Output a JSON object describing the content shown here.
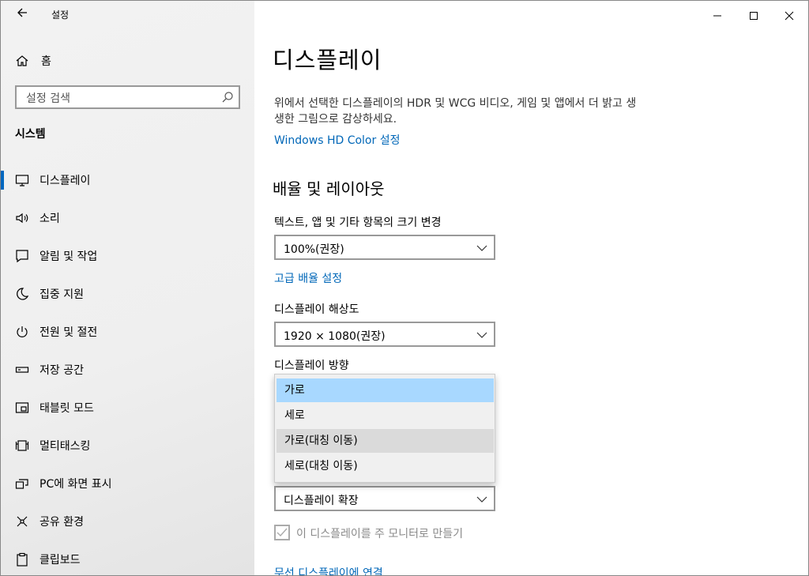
{
  "titlebar": {
    "title": "설정"
  },
  "sidebar": {
    "home_label": "홈",
    "search_placeholder": "설정 검색",
    "section": "시스템",
    "items": [
      {
        "label": "디스플레이",
        "icon": "monitor-icon",
        "selected": true
      },
      {
        "label": "소리",
        "icon": "speaker-icon"
      },
      {
        "label": "알림 및 작업",
        "icon": "notification-icon"
      },
      {
        "label": "집중 지원",
        "icon": "moon-icon"
      },
      {
        "label": "전원 및 절전",
        "icon": "power-icon"
      },
      {
        "label": "저장 공간",
        "icon": "storage-icon"
      },
      {
        "label": "태블릿 모드",
        "icon": "tablet-icon"
      },
      {
        "label": "멀티태스킹",
        "icon": "multitasking-icon"
      },
      {
        "label": "PC에 화면 표시",
        "icon": "project-icon"
      },
      {
        "label": "공유 환경",
        "icon": "share-icon"
      },
      {
        "label": "클립보드",
        "icon": "clipboard-icon"
      }
    ]
  },
  "main": {
    "title": "디스플레이",
    "description": "위에서 선택한 디스플레이의 HDR 및 WCG 비디오, 게임 및 앱에서 더 밝고 생생한 그림으로 감상하세요.",
    "hdr_link": "Windows HD Color 설정",
    "scale_heading": "배율 및 레이아웃",
    "text_size_label": "텍스트, 앱 및 기타 항목의 크기 변경",
    "text_size_value": "100%(권장)",
    "advanced_scaling_link": "고급 배율 설정",
    "resolution_label": "디스플레이 해상도",
    "resolution_value": "1920 × 1080(권장)",
    "orientation_label": "디스플레이 방향",
    "orientation_options": [
      "가로",
      "세로",
      "가로(대칭 이동)",
      "세로(대칭 이동)"
    ],
    "orientation_selected": "가로",
    "multi_display_value": "디스플레이 확장",
    "main_display_checkbox": "이 디스플레이를 주 모니터로 만들기",
    "wireless_link": "무선 디스플레이에 연결"
  },
  "colors": {
    "accent": "#0067c0",
    "link": "#0067b8",
    "selected_option": "#a8d8ff"
  }
}
